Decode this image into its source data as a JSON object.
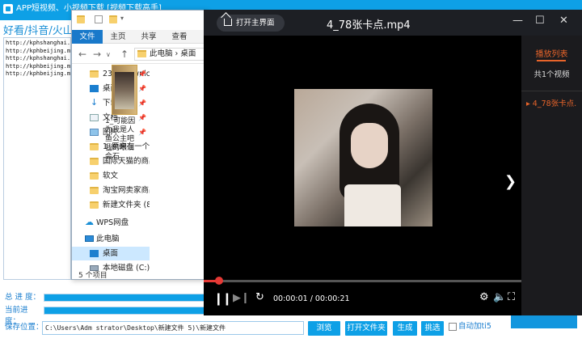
{
  "app": {
    "title": "APP短视频、小视频下载 [视频下载高手]",
    "platforms": "好看/抖音/火山",
    "urls": [
      "http://kphshanghai.",
      "http://kphbeijing.m",
      "http://kphshanghai.",
      "http://kphbeijing.m",
      "http://kphbeijing.m"
    ],
    "total_progress_label": "总 进 度：",
    "current_progress_label": "当前进度：",
    "total_progress": 1.0,
    "current_progress": 1.0,
    "save_label": "保存位置：",
    "save_path": "C:\\Users\\Adm      strator\\Desktop\\新建文件      5)\\新建文件",
    "buttons": {
      "browse": "浏览",
      "open_folder": "打开文件夹",
      "generate": "生成",
      "select": "挑选"
    },
    "auto_add_label": "自动加ti5"
  },
  "explorer": {
    "tabs": [
      "文件",
      "主页",
      "共享",
      "查看"
    ],
    "address": "此电脑 › 桌面",
    "sidebar": [
      {
        "label": "2345Downlc",
        "icon": "folder-icon",
        "pinned": true
      },
      {
        "label": "桌面",
        "icon": "desktop-icon",
        "pinned": true
      },
      {
        "label": "下载",
        "icon": "download-icon",
        "pinned": true
      },
      {
        "label": "文档",
        "icon": "document-icon",
        "pinned": true
      },
      {
        "label": "图片",
        "icon": "picture-icon",
        "pinned": true
      },
      {
        "label": "1_原来在一个",
        "icon": "folder-icon",
        "pinned": false
      },
      {
        "label": "国际天猫的商品",
        "icon": "folder-icon",
        "pinned": false
      },
      {
        "label": "软文",
        "icon": "folder-icon",
        "pinned": false
      },
      {
        "label": "淘宝网卖家商品",
        "icon": "folder-icon",
        "pinned": false
      },
      {
        "label": "新建文件夹 (8)",
        "icon": "folder-icon",
        "pinned": false
      },
      {
        "label": "WPS网盘",
        "icon": "cloud-icon",
        "pinned": false
      },
      {
        "label": "此电脑",
        "icon": "computer-icon",
        "pinned": false
      },
      {
        "label": "桌面",
        "icon": "desktop-icon",
        "pinned": false,
        "selected": true
      },
      {
        "label": "本地磁盘 (C:)",
        "icon": "disk-icon",
        "pinned": false
      }
    ],
    "file_name": "1_可能因为我是人鱼公主吧我的眼泪会石",
    "status": "5 个项目"
  },
  "player": {
    "home_button": "打开主界面",
    "title": "4_78张卡点.mp4",
    "current_time": "00:00:01",
    "total_time": "00:00:21",
    "time_separator": " / ",
    "progress": 0.048,
    "playlist_tab": "播放列表",
    "playlist_count": "共1个视频",
    "playlist_items": [
      "4_78张卡点."
    ]
  },
  "colors": {
    "app_blue": "#0ea0e6",
    "accent_orange": "#e8642a",
    "seek_red": "#e53935"
  }
}
